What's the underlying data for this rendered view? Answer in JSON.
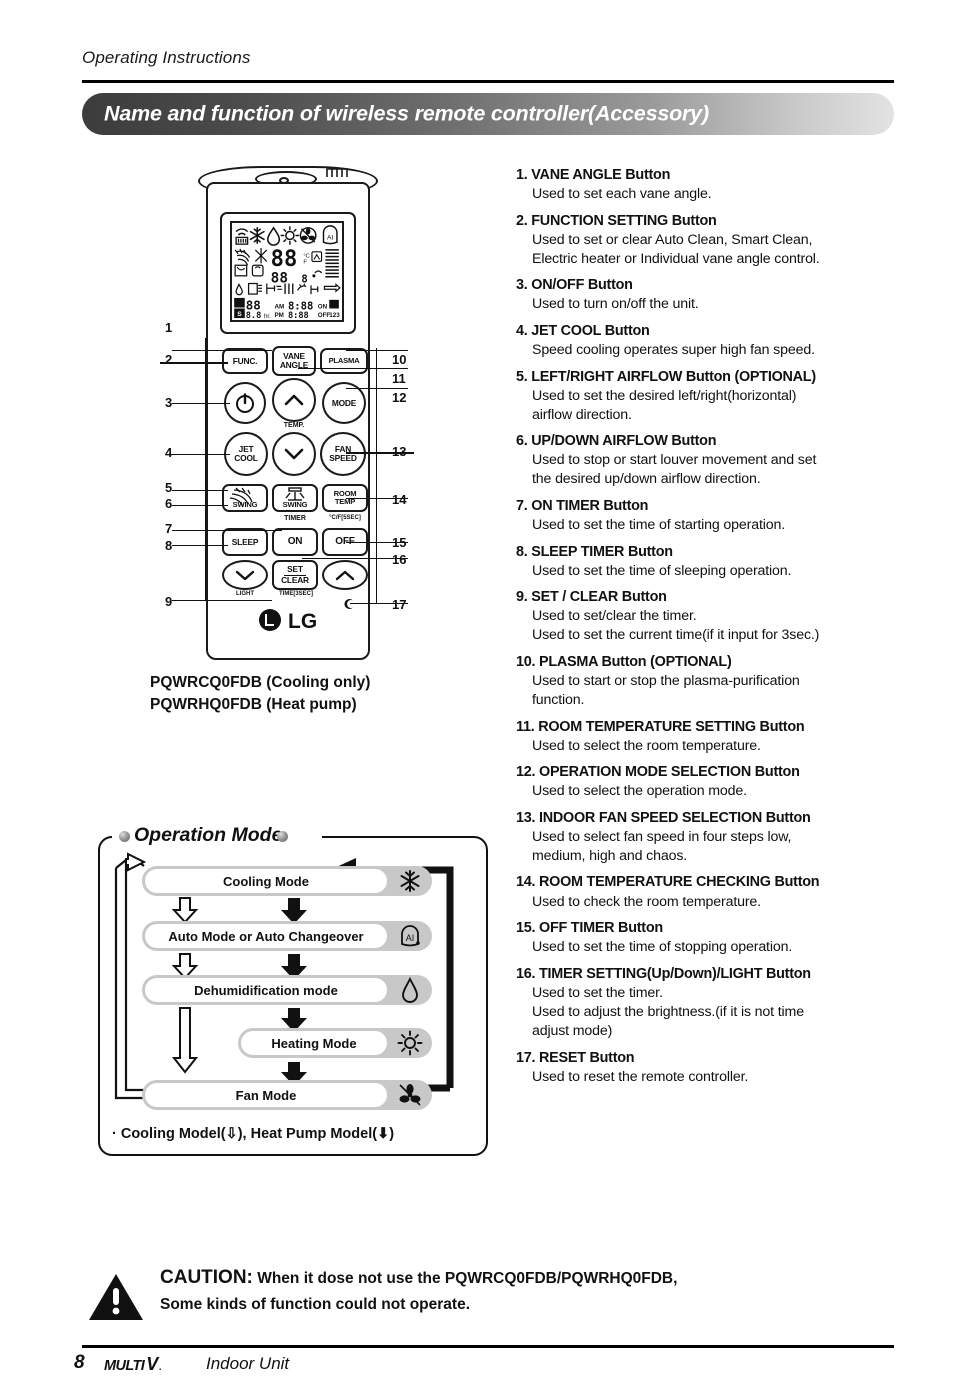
{
  "header": {
    "running_head": "Operating Instructions",
    "title": "Name and function of wireless remote controller(Accessory)"
  },
  "remote": {
    "buttons": {
      "func": "FUNC.",
      "vane_angle_line1": "VANE",
      "vane_angle_line2": "ANGLE",
      "plasma": "PLASMA",
      "mode": "MODE",
      "jet_cool_line1": "JET",
      "jet_cool_line2": "COOL",
      "fan_speed_line1": "FAN",
      "fan_speed_line2": "SPEED",
      "swing_left": "SWING",
      "swing_right": "SWING",
      "room_temp_line1": "ROOM",
      "room_temp_line2": "TEMP",
      "sleep": "SLEEP",
      "on": "ON",
      "off": "OFF",
      "set": "SET",
      "clear": "CLEAR"
    },
    "sublabels": {
      "temp": "TEMP.",
      "timer": "TIMER",
      "celsius_fahrenheit": "°C/F[5SEC]",
      "light": "LIGHT",
      "time_3sec": "TIME[3SEC]"
    },
    "lcd": {
      "digits_main": "88",
      "digits_sub": "88",
      "digit_small": "8",
      "unit": "°C/F",
      "timer_hours": "88",
      "timer_hours_small": "8.8",
      "hr_label": "hr.",
      "am_label": "AM",
      "pm_label": "PM",
      "clock_left": "8:88",
      "clock_right": "8:88",
      "on_label": "ON",
      "off_label": "OFF",
      "weekdays": "123",
      "s_label": "S"
    },
    "brand": "LG",
    "callouts_left": [
      "1",
      "2",
      "3",
      "4",
      "5",
      "6",
      "7",
      "8",
      "9"
    ],
    "callouts_right": [
      "10",
      "11",
      "12",
      "13",
      "14",
      "15",
      "16",
      "17"
    ],
    "model_line1": "PQWRCQ0FDB (Cooling only)",
    "model_line2": "PQWRHQ0FDB (Heat pump)"
  },
  "operation_mode": {
    "title": "Operation Mode",
    "modes": [
      {
        "label": "Cooling Mode",
        "icon": "snowflake-icon"
      },
      {
        "label": "Auto Mode or Auto Changeover",
        "icon": "ai-icon"
      },
      {
        "label": "Dehumidification mode",
        "icon": "water-drop-icon"
      },
      {
        "label": "Heating Mode",
        "icon": "sun-icon"
      },
      {
        "label": "Fan Mode",
        "icon": "fan-icon"
      }
    ],
    "legend": "· Cooling Model(⇩), Heat Pump Model(⬇)"
  },
  "descriptions": [
    {
      "num": "1.",
      "title": "VANE ANGLE Button",
      "lines": [
        "Used to set each vane angle."
      ]
    },
    {
      "num": "2.",
      "title": "FUNCTION SETTING Button",
      "lines": [
        "Used to set or clear Auto Clean, Smart Clean,",
        "Electric heater or Individual vane angle control."
      ]
    },
    {
      "num": "3.",
      "title": " ON/OFF Button",
      "lines": [
        " Used to turn on/off the unit."
      ]
    },
    {
      "num": "4.",
      "title": "JET COOL Button",
      "lines": [
        "Speed cooling operates super high fan speed."
      ]
    },
    {
      "num": "5.",
      "title": "LEFT/RIGHT AIRFLOW Button (OPTIONAL)",
      "lines": [
        "Used to set the desired left/right(horizontal)",
        "airflow direction."
      ]
    },
    {
      "num": "6.",
      "title": "UP/DOWN AIRFLOW Button",
      "lines": [
        "Used to stop or start louver movement and set",
        "the desired up/down airflow direction."
      ]
    },
    {
      "num": "7.",
      "title": "ON TIMER Button",
      "lines": [
        "Used to set the time of starting operation."
      ]
    },
    {
      "num": "8.",
      "title": "SLEEP TIMER Button",
      "lines": [
        "Used to set the time of sleeping operation."
      ]
    },
    {
      "num": "9.",
      "title": "SET / CLEAR Button",
      "lines": [
        "Used to set/clear the timer.",
        "Used to set the current time(if it input for 3sec.)"
      ]
    },
    {
      "num": "10.",
      "title": "PLASMA Button (OPTIONAL)",
      "lines": [
        "Used to start or stop the plasma-purification",
        "function."
      ]
    },
    {
      "num": "11.",
      "title": "ROOM TEMPERATURE SETTING Button",
      "lines": [
        "Used to select the room temperature."
      ]
    },
    {
      "num": "12.",
      "title": "OPERATION MODE SELECTION Button",
      "lines": [
        "Used to select the operation mode."
      ]
    },
    {
      "num": "13.",
      "title": "INDOOR FAN SPEED SELECTION Button",
      "lines": [
        "Used to select fan speed in four steps low,",
        "medium, high and chaos."
      ]
    },
    {
      "num": "14.",
      "title": "ROOM TEMPERATURE CHECKING Button",
      "lines": [
        "Used to check the room temperature."
      ]
    },
    {
      "num": "15.",
      "title": "OFF TIMER Button",
      "lines": [
        "Used to set the time of stopping operation."
      ]
    },
    {
      "num": "16.",
      "title": "TIMER SETTING(Up/Down)/LIGHT Button",
      "lines": [
        "Used to set the timer.",
        "Used to adjust the brightness.(if it is not time",
        "adjust mode)"
      ]
    },
    {
      "num": "17.",
      "title": "RESET Button",
      "lines": [
        "Used to reset the remote controller."
      ]
    }
  ],
  "caution": {
    "label": "CAUTION:",
    "line1": "When it dose not use the PQWRCQ0FDB/PQWRHQ0FDB,",
    "line2": "Some kinds of function could not operate."
  },
  "footer": {
    "page_number": "8",
    "brand_multi": "MULTI",
    "brand_v": "V",
    "brand_dot": ".",
    "unit": "Indoor Unit"
  }
}
